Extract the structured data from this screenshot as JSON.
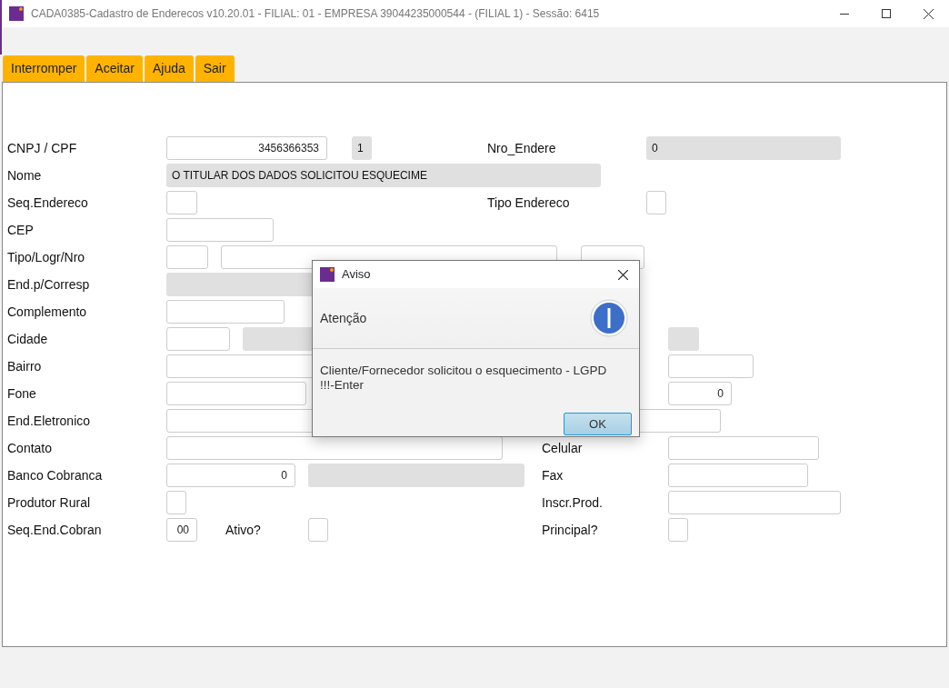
{
  "window": {
    "title": "CADA0385-Cadastro de Enderecos v10.20.01   - FILIAL: 01 - EMPRESA 39044235000544 - (FILIAL 1) - Sessão: 6415"
  },
  "toolbar": [
    {
      "label": "Interromper"
    },
    {
      "label": "Aceitar"
    },
    {
      "label": "Ajuda"
    },
    {
      "label": "Sair"
    }
  ],
  "form_rows": [
    {
      "items": [
        {
          "kind": "label",
          "text": "CNPJ / CPF"
        },
        {
          "kind": "number_input",
          "value": "3456366353"
        },
        {
          "kind": "readonly",
          "value": "1"
        },
        {
          "kind": "label",
          "text": "Nro_Endere"
        },
        {
          "kind": "readonly",
          "value": "0"
        }
      ]
    },
    {
      "items": [
        {
          "kind": "label",
          "text": "Nome"
        },
        {
          "kind": "readonly",
          "value": "O TITULAR DOS DADOS SOLICITOU ESQUECIME"
        }
      ]
    },
    {
      "items": [
        {
          "kind": "label",
          "text": "Seq.Endereco"
        },
        {
          "kind": "input"
        },
        {
          "kind": "label",
          "text": "Tipo Endereco"
        },
        {
          "kind": "input"
        }
      ]
    },
    {
      "items": [
        {
          "kind": "label",
          "text": "CEP"
        },
        {
          "kind": "input"
        }
      ]
    },
    {
      "items": [
        {
          "kind": "label",
          "text": "Tipo/Logr/Nro"
        },
        {
          "kind": "input"
        },
        {
          "kind": "input"
        },
        {
          "kind": "input"
        }
      ]
    },
    {
      "items": [
        {
          "kind": "label",
          "text": "End.p/Corresp"
        },
        {
          "kind": "readonly"
        }
      ]
    },
    {
      "items": [
        {
          "kind": "label",
          "text": "Complemento"
        },
        {
          "kind": "input"
        }
      ]
    },
    {
      "items": [
        {
          "kind": "label",
          "text": "Cidade"
        },
        {
          "kind": "input"
        },
        {
          "kind": "readonly"
        },
        {
          "kind": "readonly"
        }
      ]
    },
    {
      "items": [
        {
          "kind": "label",
          "text": "Bairro"
        },
        {
          "kind": "input"
        },
        {
          "kind": "input"
        }
      ]
    },
    {
      "items": [
        {
          "kind": "label",
          "text": "Fone"
        },
        {
          "kind": "input"
        },
        {
          "kind": "number_input",
          "value": "0"
        }
      ]
    },
    {
      "items": [
        {
          "kind": "label",
          "text": "End.Eletronico"
        },
        {
          "kind": "input"
        },
        {
          "kind": "input"
        }
      ]
    },
    {
      "items": [
        {
          "kind": "label",
          "text": "Contato"
        },
        {
          "kind": "input"
        },
        {
          "kind": "label",
          "text": "Celular"
        },
        {
          "kind": "input"
        }
      ]
    },
    {
      "items": [
        {
          "kind": "label",
          "text": "Banco Cobranca"
        },
        {
          "kind": "number_input",
          "value": "0"
        },
        {
          "kind": "readonly"
        },
        {
          "kind": "label",
          "text": "Fax"
        },
        {
          "kind": "input"
        }
      ]
    },
    {
      "items": [
        {
          "kind": "label",
          "text": "Produtor Rural"
        },
        {
          "kind": "checkbox",
          "checked": false
        },
        {
          "kind": "label",
          "text": "Inscr.Prod."
        },
        {
          "kind": "input"
        }
      ]
    },
    {
      "items": [
        {
          "kind": "label",
          "text": "Seq.End.Cobran"
        },
        {
          "kind": "number_input",
          "value": "00"
        },
        {
          "kind": "label",
          "text": "Ativo?"
        },
        {
          "kind": "checkbox",
          "checked": false
        },
        {
          "kind": "label",
          "text": "Principal?"
        },
        {
          "kind": "checkbox",
          "checked": false
        }
      ]
    }
  ],
  "dialog": {
    "title": "Aviso",
    "heading": "Atenção",
    "message": "Cliente/Fornecedor solicitou o esquecimento - LGPD\n!!!-Enter",
    "button": "OK"
  }
}
